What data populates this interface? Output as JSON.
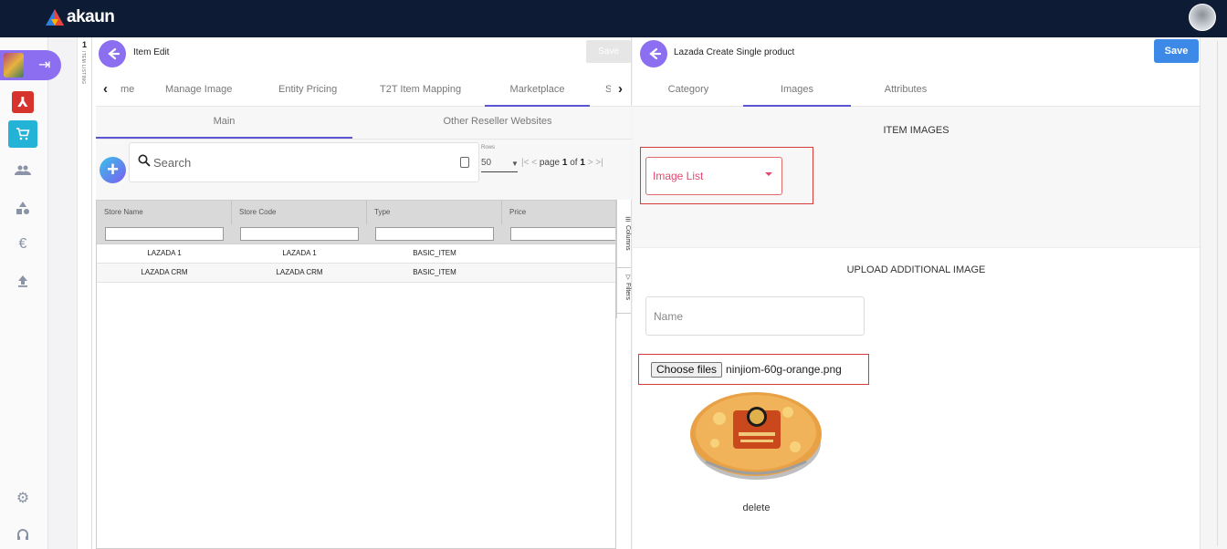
{
  "app": {
    "logo_text": "akaun"
  },
  "nav": {
    "items": [
      {
        "name": "pdf-app-icon",
        "glyph": "⅄"
      },
      {
        "name": "cart-icon",
        "glyph": "🛒"
      },
      {
        "name": "people-icon",
        "glyph": "👥"
      },
      {
        "name": "shapes-icon",
        "glyph": "▲"
      },
      {
        "name": "euro-icon",
        "glyph": "€"
      },
      {
        "name": "upload-icon",
        "glyph": "⤒"
      },
      {
        "name": "settings-icon",
        "glyph": "⚙"
      },
      {
        "name": "support-icon",
        "glyph": "∩"
      }
    ]
  },
  "listing_strip": {
    "number": "1",
    "label": "ITEM LISTING"
  },
  "left_panel": {
    "title": "Item Edit",
    "save_label": "Save",
    "tabs": [
      "me",
      "Manage Image",
      "Entity Pricing",
      "T2T Item Mapping",
      "Marketplace",
      "S"
    ],
    "active_tab": "Marketplace",
    "subtabs": [
      "Main",
      "Other Reseller Websites"
    ],
    "search_placeholder": "Search",
    "pager": {
      "rows_label": "Rows",
      "rows_value": "50",
      "page_label": "page",
      "page_current": "1",
      "of_label": "of",
      "page_total": "1"
    },
    "grid": {
      "columns": [
        "Store Name",
        "Store Code",
        "Type",
        "Price"
      ],
      "rows": [
        [
          "LAZADA 1",
          "LAZADA 1",
          "BASIC_ITEM",
          ""
        ],
        [
          "LAZADA CRM",
          "LAZADA CRM",
          "BASIC_ITEM",
          ""
        ]
      ],
      "side_tools": [
        "Columns",
        "Filters"
      ]
    }
  },
  "right_panel": {
    "title": "Lazada Create Single product",
    "save_label": "Save",
    "tabs": [
      "Category",
      "Images",
      "Attributes"
    ],
    "active_tab": "Images",
    "item_images_heading": "ITEM IMAGES",
    "image_list_label": "Image List",
    "upload_heading": "UPLOAD ADDITIONAL IMAGE",
    "name_placeholder": "Name",
    "choose_files_label": "Choose files",
    "file_name": "ninjiom-60g-orange.png",
    "delete_label": "delete"
  },
  "colors": {
    "topbar": "#0d1c34",
    "accent_purple": "#8b6ff0",
    "save_blue": "#3c89e8",
    "highlight_red": "#d63b3b",
    "image_list_pink": "#e04a6f"
  }
}
